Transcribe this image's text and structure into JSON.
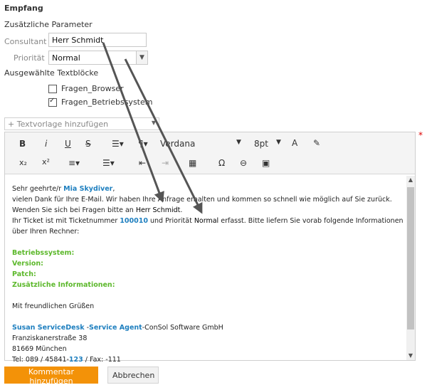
{
  "section_title": "Empfang",
  "params_heading": "Zusätzliche Parameter",
  "consultant": {
    "label": "Consultant",
    "value": "Herr Schmidt"
  },
  "priority": {
    "label": "Priorität",
    "value": "Normal"
  },
  "textblocks": {
    "heading": "Ausgewählte Textblöcke",
    "items": [
      {
        "label": "Fragen_Browser",
        "checked": false
      },
      {
        "label": "Fragen_Betriebssystem",
        "checked": true
      }
    ]
  },
  "template_select": {
    "placeholder": "+ Textvorlage hinzufügen"
  },
  "toolbar": {
    "bold": "B",
    "italic": "i",
    "underline": "U",
    "strike": "S",
    "font": "Verdana",
    "size": "8pt",
    "subscript": "x₂",
    "superscript": "x²",
    "omega": "Ω"
  },
  "message": {
    "greeting_prefix": "Sehr geehrte/r ",
    "customer_name": "Mia Skydiver",
    "greeting_suffix": ",",
    "line2": "vielen Dank für Ihre E-Mail. Wir haben Ihre Anfrage erhalten und kommen so schnell wie möglich auf Sie zurück.",
    "line3_prefix": "Wenden Sie sich bei Fragen bitte an ",
    "line3_consultant": "Herr Schmidt",
    "line3_suffix": ".",
    "line4_a": "Ihr Ticket ist mit Ticketnummer ",
    "ticket_number": "100010",
    "line4_b": " und Priorität ",
    "line4_priority": "Normal",
    "line4_c": " erfasst. Bitte liefern Sie vorab folgende Informationen",
    "line5": "über Ihren Rechner:",
    "fields": [
      "Betriebssystem:",
      "Version:",
      "Patch:",
      "Zusätzliche Informationen:"
    ],
    "closing": "Mit freundlichen Grüßen",
    "sig_name": "Susan ServiceDesk",
    "sig_dash": " -",
    "sig_role": "Service Agent",
    "sig_company": "-ConSol Software GmbH",
    "sig_street": "Franziskanerstraße 38",
    "sig_city": "81669 München",
    "sig_tel_prefix": "Tel: 089 / 45841-",
    "sig_tel_ext": "123",
    "sig_tel_suffix": " / Fax: -111"
  },
  "buttons": {
    "add_comment": "Kommentar hinzufügen",
    "cancel": "Abbrechen"
  },
  "colors": {
    "accent_orange": "#f39208",
    "link_blue": "#1e7fbf",
    "field_green": "#5cb82b"
  }
}
